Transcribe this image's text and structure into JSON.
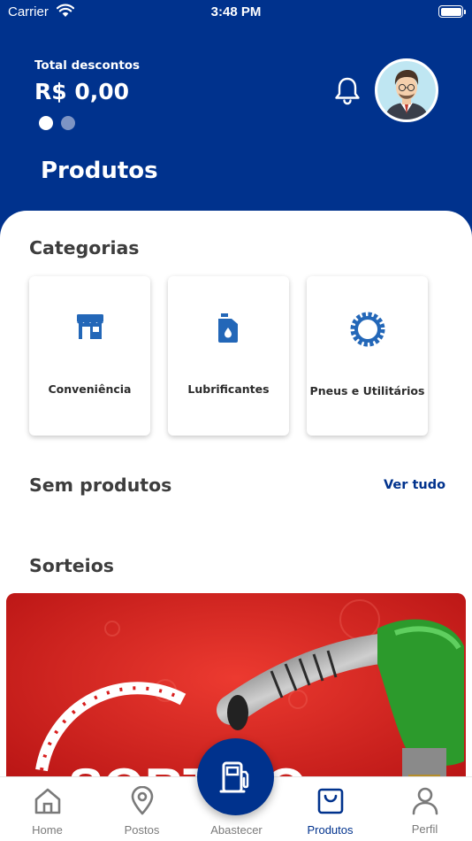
{
  "status_bar": {
    "carrier": "Carrier",
    "time": "3:48 PM"
  },
  "header": {
    "discount_label": "Total descontos",
    "discount_value": "R$ 0,00",
    "carousel_pages": 2,
    "carousel_active_index": 0,
    "title": "Produtos"
  },
  "categories": {
    "title": "Categorias",
    "items": [
      {
        "label": "Conveniência",
        "icon": "store-icon"
      },
      {
        "label": "Lubrificantes",
        "icon": "oil-can-icon"
      },
      {
        "label": "Pneus e Utilitários",
        "icon": "gear-icon"
      }
    ]
  },
  "products": {
    "title": "Sem produtos",
    "see_all": "Ver tudo"
  },
  "raffles": {
    "title": "Sorteios",
    "banner_text": "SORTEIO"
  },
  "tabbar": {
    "items": [
      {
        "label": "Home",
        "icon": "home-icon"
      },
      {
        "label": "Postos",
        "icon": "location-pin-icon"
      },
      {
        "label": "Abastecer",
        "icon": "fuel-pump-icon"
      },
      {
        "label": "Produtos",
        "icon": "shopping-bag-icon"
      },
      {
        "label": "Perfil",
        "icon": "user-icon"
      }
    ],
    "active_index": 3
  },
  "colors": {
    "primary": "#00328d",
    "banner_red": "#d81d1d",
    "nozzle_green": "#2c9a2c"
  }
}
